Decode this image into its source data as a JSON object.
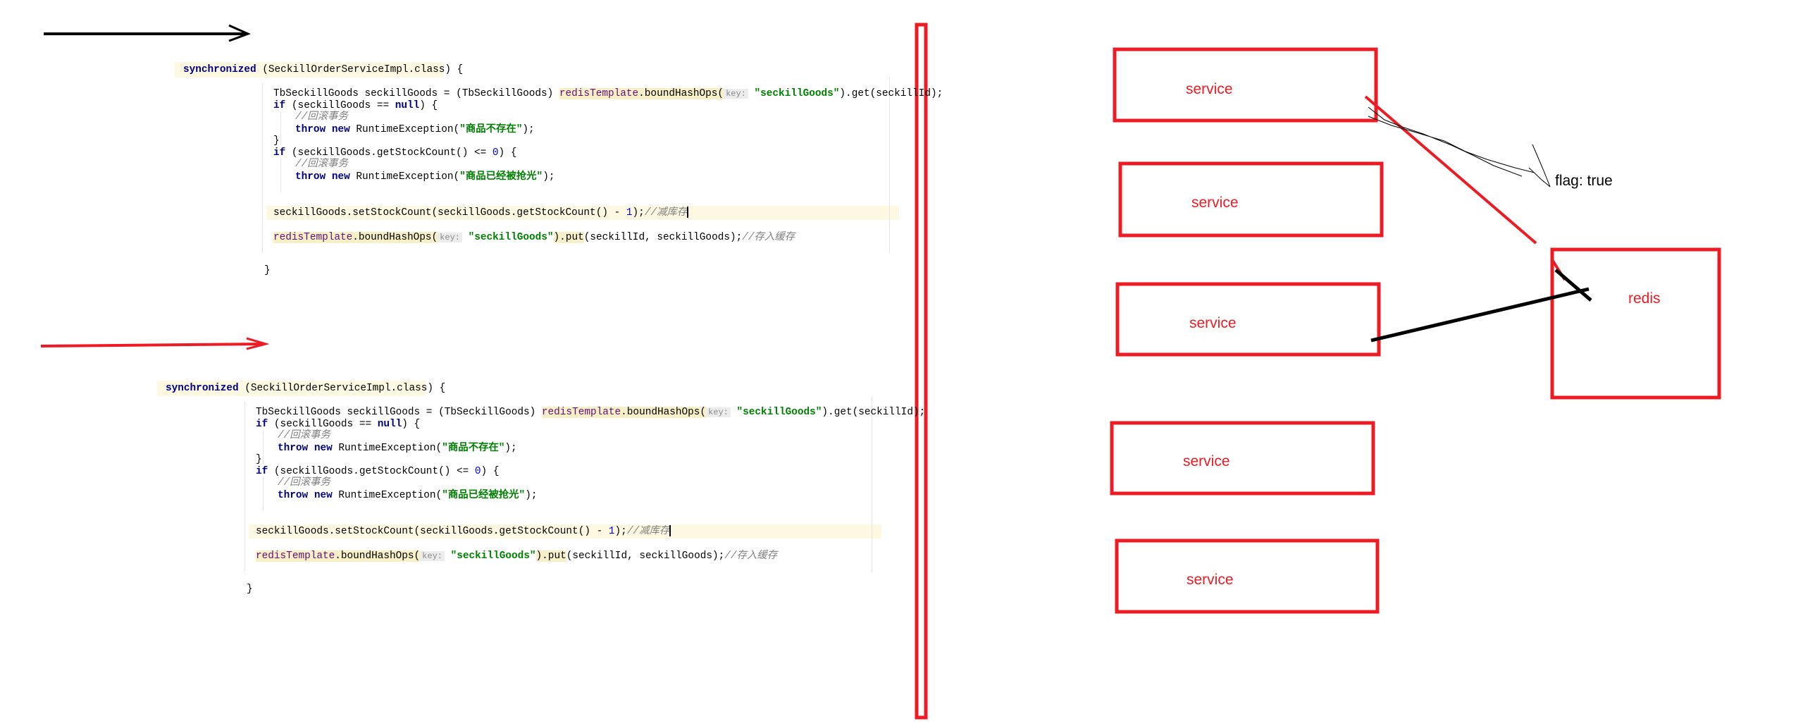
{
  "code_block": {
    "lines": [
      [
        {
          "t": "synchronized",
          "c": "kw"
        },
        {
          "t": " (SeckillOrderServiceImpl.class) {"
        }
      ],
      [
        {
          "t": "TbSeckillGoods seckillGoods = (TbSeckillGoods) "
        },
        {
          "t": "redisTemplate",
          "c": "fld"
        },
        {
          "t": ".boundHashOps(",
          "c": "hl"
        },
        {
          "t": "key:",
          "c": "hint"
        },
        {
          "t": " "
        },
        {
          "t": "\"seckillGoods\"",
          "c": "str"
        },
        {
          "t": ").get(seckillId);"
        }
      ],
      [
        {
          "t": "if",
          "c": "kw"
        },
        {
          "t": " (seckillGoods == "
        },
        {
          "t": "null",
          "c": "kw"
        },
        {
          "t": ") {"
        }
      ],
      [
        {
          "t": "//回滚事务",
          "c": "cm"
        }
      ],
      [
        {
          "t": "throw new",
          "c": "kw"
        },
        {
          "t": " RuntimeException("
        },
        {
          "t": "\"商品不存在\"",
          "c": "str"
        },
        {
          "t": ");"
        }
      ],
      [
        {
          "t": "}"
        }
      ],
      [
        {
          "t": "if",
          "c": "kw"
        },
        {
          "t": " (seckillGoods.getStockCount() <= "
        },
        {
          "t": "0",
          "c": "num"
        },
        {
          "t": ") {"
        }
      ],
      [
        {
          "t": "//回滚事务",
          "c": "cm"
        }
      ],
      [
        {
          "t": "throw new",
          "c": "kw"
        },
        {
          "t": " RuntimeException("
        },
        {
          "t": "\"商品已经被抢光\"",
          "c": "str"
        },
        {
          "t": ");"
        }
      ],
      [
        {
          "t": "seckillGoods.setStockCount(seckillGoods.getStockCount() - "
        },
        {
          "t": "1",
          "c": "num"
        },
        {
          "t": ");"
        },
        {
          "t": "//减库存",
          "c": "cm"
        }
      ],
      [
        {
          "t": "redisTemplate",
          "c": "fld"
        },
        {
          "t": ".boundHashOps(",
          "c": "hl"
        },
        {
          "t": "key:",
          "c": "hint"
        },
        {
          "t": " "
        },
        {
          "t": "\"seckillGoods\"",
          "c": "str"
        },
        {
          "t": ").put",
          "c": "hl"
        },
        {
          "t": "(seckillId, seckillGoods);"
        },
        {
          "t": "//存入缓存",
          "c": "cm"
        }
      ],
      [
        {
          "t": "}"
        }
      ]
    ]
  },
  "diagram": {
    "service_label": "service",
    "services": [
      "service",
      "service",
      "service",
      "service",
      "service"
    ],
    "redis_label": "redis",
    "flag_label": "flag: true",
    "colors": {
      "red": "#ed1c24",
      "black": "#000000"
    }
  }
}
